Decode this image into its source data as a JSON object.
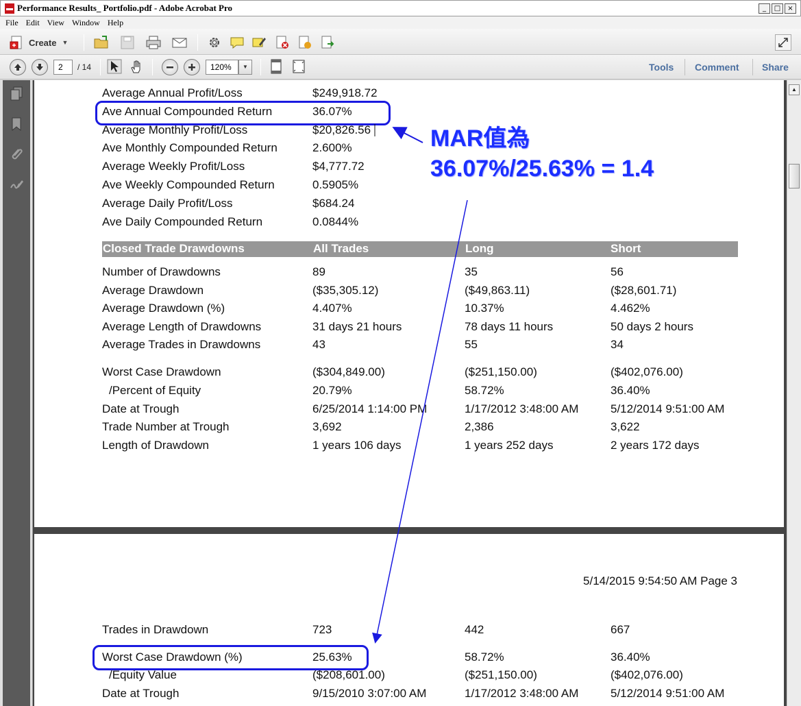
{
  "window": {
    "title": "Performance Results_ Portfolio.pdf - Adobe Acrobat Pro",
    "controls": [
      "_",
      "□",
      "×"
    ]
  },
  "menu": [
    "File",
    "Edit",
    "View",
    "Window",
    "Help"
  ],
  "toolbar": {
    "create_label": "Create"
  },
  "nav": {
    "page_number": "2",
    "page_total": "/ 14",
    "zoom": "120%",
    "tabs": [
      "Tools",
      "Comment",
      "Share"
    ]
  },
  "report": {
    "summary_rows": [
      {
        "label": "Average Annual Profit/Loss",
        "value": "$249,918.72"
      },
      {
        "label": "Ave Annual Compounded Return",
        "value": "36.07%"
      },
      {
        "label": "Average Monthly Profit/Loss",
        "value": "$20,826.56"
      },
      {
        "label": "Ave Monthly Compounded Return",
        "value": "2.600%"
      },
      {
        "label": "Average Weekly Profit/Loss",
        "value": "$4,777.72"
      },
      {
        "label": "Ave Weekly Compounded Return",
        "value": "0.5905%"
      },
      {
        "label": "Average Daily Profit/Loss",
        "value": "$684.24"
      },
      {
        "label": "Ave Daily Compounded Return",
        "value": "0.0844%"
      }
    ],
    "drawdown_header": [
      "Closed Trade Drawdowns",
      "All Trades",
      "Long",
      "Short"
    ],
    "drawdown_rows": [
      [
        "Number of Drawdowns",
        "89",
        "35",
        "56"
      ],
      [
        "Average Drawdown",
        "($35,305.12)",
        "($49,863.11)",
        "($28,601.71)"
      ],
      [
        "Average Drawdown (%)",
        "4.407%",
        "10.37%",
        "4.462%"
      ],
      [
        "Average Length of Drawdowns",
        "31 days 21 hours",
        "78 days 11 hours",
        "50 days 2 hours"
      ],
      [
        "Average Trades in Drawdowns",
        "43",
        "55",
        "34"
      ]
    ],
    "worst_rows": [
      [
        "Worst Case Drawdown",
        "($304,849.00)",
        "($251,150.00)",
        "($402,076.00)"
      ],
      [
        "/Percent of Equity",
        "20.79%",
        "58.72%",
        "36.40%"
      ],
      [
        "Date at Trough",
        "6/25/2014 1:14:00 PM",
        "1/17/2012 3:48:00 AM",
        "5/12/2014 9:51:00 AM"
      ],
      [
        "Trade Number at Trough",
        "3,692",
        "2,386",
        "3,622"
      ],
      [
        "Length of Drawdown",
        "1 years 106 days",
        "1 years 252 days",
        "2 years 172 days"
      ]
    ],
    "page3_header": "5/14/2015 9:54:50 AM Page 3",
    "page3_rows": [
      [
        "Trades in Drawdown",
        "723",
        "442",
        "667"
      ],
      [
        "Worst Case Drawdown (%)",
        "25.63%",
        "58.72%",
        "36.40%"
      ],
      [
        "/Equity Value",
        "($208,601.00)",
        "($251,150.00)",
        "($402,076.00)"
      ],
      [
        "Date at Trough",
        "9/15/2010 3:07:00 AM",
        "1/17/2012 3:48:00 AM",
        "5/12/2014 9:51:00 AM"
      ]
    ]
  },
  "annotation": {
    "line1": "MAR值為",
    "line2": "36.07%/25.63% = 1.4",
    "color": "#1c2fff"
  }
}
